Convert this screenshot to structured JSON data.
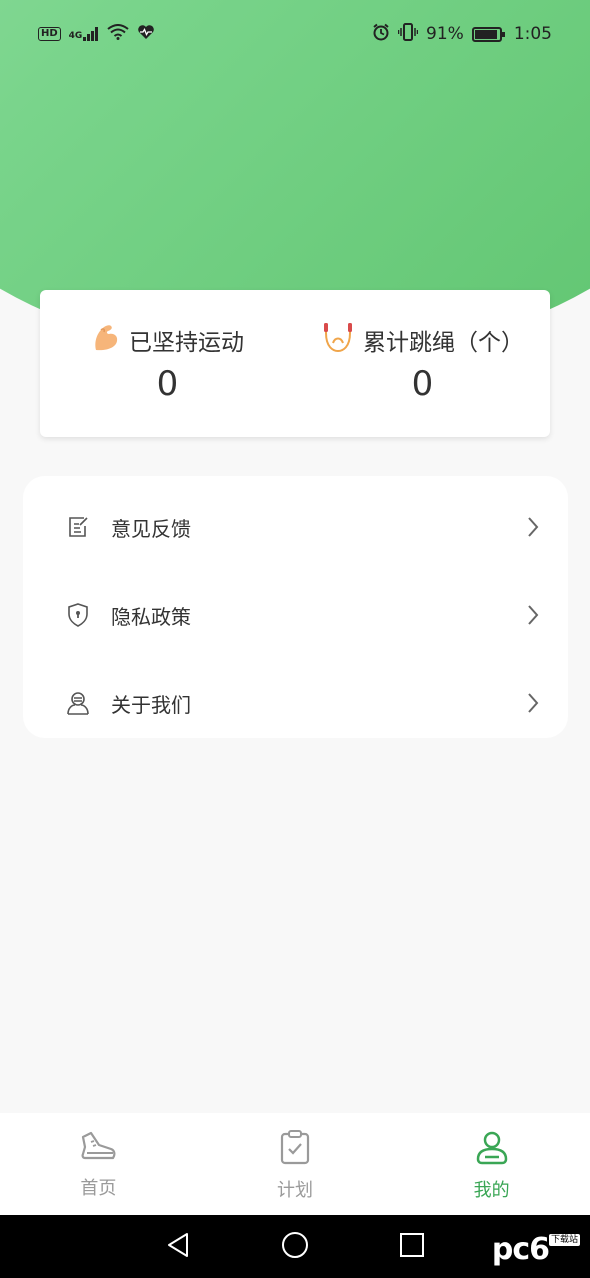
{
  "status_bar": {
    "left_badge": "HD",
    "network": "4G",
    "battery_percent": "91%",
    "time": "1:05",
    "icons": [
      "hd-icon",
      "signal-icon",
      "wifi-icon",
      "health-icon",
      "alarm-icon",
      "vibrate-icon",
      "battery-icon"
    ]
  },
  "stats": {
    "days": {
      "label": "已坚持运动",
      "value": "0",
      "icon": "flexed-arm-icon"
    },
    "jumps": {
      "label": "累计跳绳（个）",
      "value": "0",
      "icon": "jump-rope-icon"
    }
  },
  "menu": {
    "items": [
      {
        "label": "意见反馈",
        "icon": "feedback-icon"
      },
      {
        "label": "隐私政策",
        "icon": "shield-icon"
      },
      {
        "label": "关于我们",
        "icon": "about-icon"
      }
    ]
  },
  "tabbar": {
    "tabs": [
      {
        "label": "首页",
        "icon": "shoe-icon",
        "active": false
      },
      {
        "label": "计划",
        "icon": "clipboard-icon",
        "active": false
      },
      {
        "label": "我的",
        "icon": "user-icon",
        "active": true
      }
    ],
    "active_color": "#3aa655",
    "inactive_color": "#9a9a9a"
  },
  "watermark": {
    "text": "pc6",
    "sub": "下载站"
  },
  "colors": {
    "hero_start": "#9be3a8",
    "hero_end": "#5fc46f",
    "background": "#f8f8f8"
  }
}
